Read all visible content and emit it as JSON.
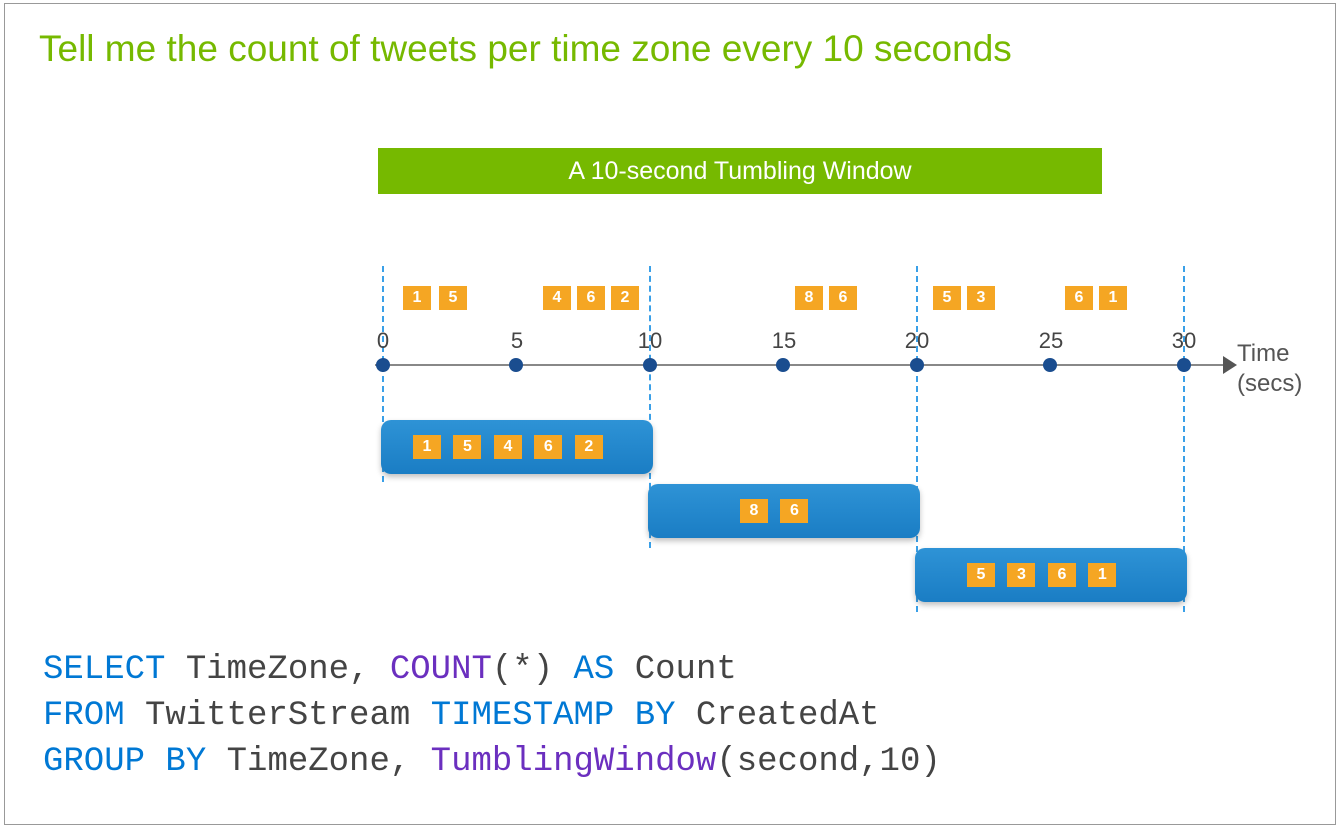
{
  "title": "Tell me the count of tweets per time zone every 10 seconds",
  "banner": "A 10-second Tumbling Window",
  "axis": {
    "time_label": "Time",
    "secs_label": "(secs)",
    "ticks": [
      "0",
      "5",
      "10",
      "15",
      "20",
      "25",
      "30"
    ]
  },
  "events_top": {
    "w1": [
      "1",
      "5",
      "4",
      "6",
      "2"
    ],
    "w2": [
      "8",
      "6"
    ],
    "w3": [
      "5",
      "3",
      "6",
      "1"
    ]
  },
  "windows": {
    "w1": [
      "1",
      "5",
      "4",
      "6",
      "2"
    ],
    "w2": [
      "8",
      "6"
    ],
    "w3": [
      "5",
      "3",
      "6",
      "1"
    ]
  },
  "sql": {
    "select": "SELECT",
    "timezone": " TimeZone, ",
    "count": "COUNT",
    "count_tail": "(*) ",
    "as": "AS",
    "count_alias": " Count",
    "from": "FROM",
    "stream": " TwitterStream ",
    "timestamp_by": "TIMESTAMP BY",
    "created_at": " CreatedAt",
    "group_by": "GROUP BY",
    "tz2": " TimeZone, ",
    "tumbling": "TumblingWindow",
    "args": "(second,10)"
  },
  "chart_data": {
    "type": "timeline-windows",
    "title": "A 10-second Tumbling Window",
    "x_ticks_seconds": [
      0,
      5,
      10,
      15,
      20,
      25,
      30
    ],
    "events": [
      {
        "t_approx": 1,
        "value": 1
      },
      {
        "t_approx": 2,
        "value": 5
      },
      {
        "t_approx": 6,
        "value": 4
      },
      {
        "t_approx": 7,
        "value": 6
      },
      {
        "t_approx": 8,
        "value": 2
      },
      {
        "t_approx": 15,
        "value": 8
      },
      {
        "t_approx": 16,
        "value": 6
      },
      {
        "t_approx": 21,
        "value": 5
      },
      {
        "t_approx": 22,
        "value": 3
      },
      {
        "t_approx": 26,
        "value": 6
      },
      {
        "t_approx": 27,
        "value": 1
      }
    ],
    "windows": [
      {
        "start": 0,
        "end": 10,
        "members": [
          1,
          5,
          4,
          6,
          2
        ]
      },
      {
        "start": 10,
        "end": 20,
        "members": [
          8,
          6
        ]
      },
      {
        "start": 20,
        "end": 30,
        "members": [
          5,
          3,
          6,
          1
        ]
      }
    ],
    "xlabel": "Time (secs)"
  }
}
